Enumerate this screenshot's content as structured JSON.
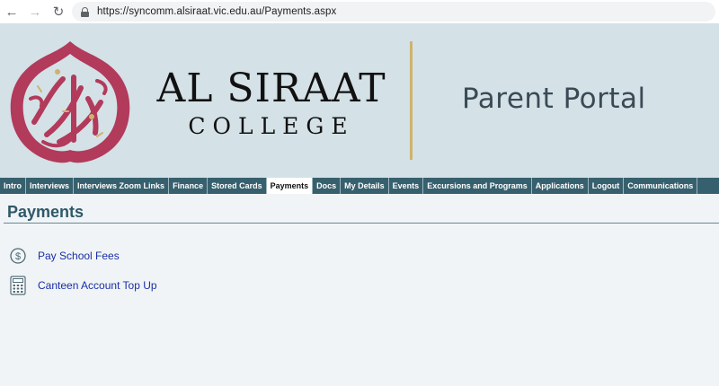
{
  "browser": {
    "url": "https://syncomm.alsiraat.vic.edu.au/Payments.aspx"
  },
  "header": {
    "college_line1": "AL SIRAAT",
    "college_line2": "COLLEGE",
    "portal_title": "Parent Portal",
    "colors": {
      "logo": "#b23a5b",
      "divider": "#cfb26e",
      "banner": "#d4e1e7"
    }
  },
  "nav": {
    "active": "Payments",
    "tabs": [
      "Intro",
      "Interviews",
      "Interviews Zoom Links",
      "Finance",
      "Stored Cards",
      "Payments",
      "Docs",
      "My Details",
      "Events",
      "Excursions and Programs",
      "Applications",
      "Logout",
      "Communications"
    ]
  },
  "main": {
    "title": "Payments",
    "links": [
      {
        "label": "Pay School Fees",
        "icon": "dollar-circle-icon"
      },
      {
        "label": "Canteen Account Top Up",
        "icon": "calculator-icon"
      }
    ]
  }
}
